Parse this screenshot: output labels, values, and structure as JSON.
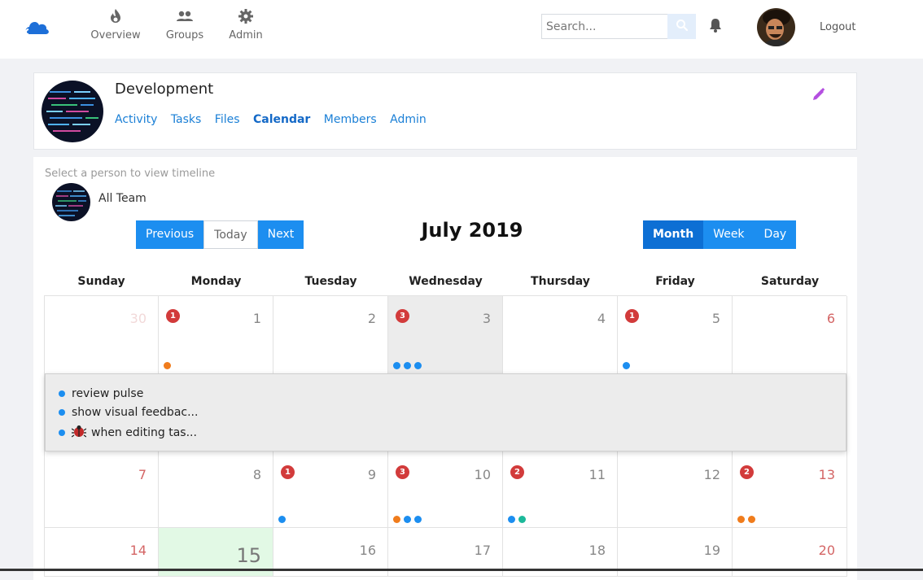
{
  "nav": {
    "items": [
      {
        "label": "Overview",
        "icon": "flame-icon"
      },
      {
        "label": "Groups",
        "icon": "groups-icon"
      },
      {
        "label": "Admin",
        "icon": "gear-icon"
      }
    ],
    "search_placeholder": "Search...",
    "logout_label": "Logout"
  },
  "group": {
    "title": "Development",
    "tabs": [
      "Activity",
      "Tasks",
      "Files",
      "Calendar",
      "Members",
      "Admin"
    ],
    "active_tab": "Calendar"
  },
  "calendar": {
    "hint": "Select a person to view timeline",
    "team_label": "All Team",
    "prev_label": "Previous",
    "today_label": "Today",
    "next_label": "Next",
    "month_title": "July 2019",
    "view_month": "Month",
    "view_week": "Week",
    "view_day": "Day",
    "weekdays": [
      "Sunday",
      "Monday",
      "Tuesday",
      "Wednesday",
      "Thursday",
      "Friday",
      "Saturday"
    ],
    "weeks": [
      [
        "30",
        "1",
        "2",
        "3",
        "4",
        "5",
        "6"
      ],
      [
        "7",
        "8",
        "9",
        "10",
        "11",
        "12",
        "13"
      ],
      [
        "14",
        "15",
        "16",
        "17",
        "18",
        "19",
        "20"
      ]
    ],
    "badges": {
      "0-1": "1",
      "0-3": "3",
      "0-5": "1",
      "1-2": "1",
      "1-3": "3",
      "1-4": "2",
      "1-6": "2"
    },
    "popover_items": [
      "review pulse",
      "show visual feedbac...",
      "when editing tas..."
    ]
  },
  "colors": {
    "primary": "#1c8ef0",
    "badge": "#d23b3b",
    "dot_blue": "#1c8ef0",
    "dot_orange": "#f07c1c",
    "dot_teal": "#1cb99a",
    "today_bg": "#e2f9e5",
    "weekend_text": "#d46565",
    "edit_icon": "#b44fe0"
  }
}
